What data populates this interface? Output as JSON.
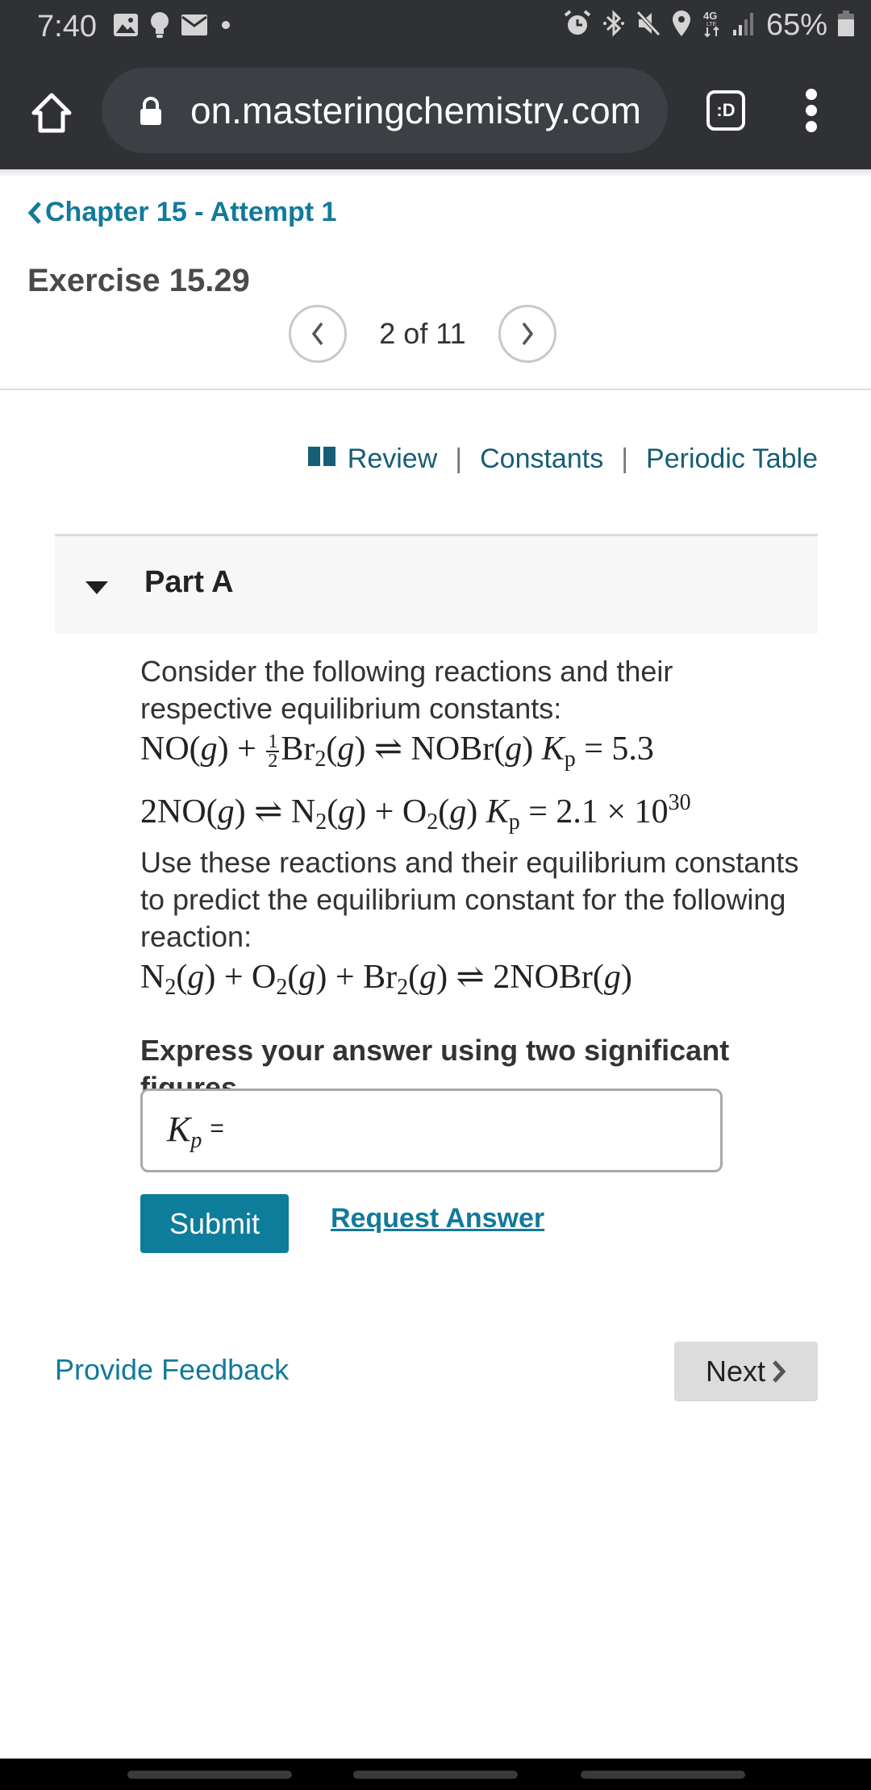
{
  "status_bar": {
    "time": "7:40",
    "left_icons": [
      "gallery-icon",
      "bulb-icon",
      "mail-icon",
      "dot-icon"
    ],
    "right_icons": [
      "alarm-icon",
      "bluetooth-icon",
      "mute-icon",
      "location-icon",
      "4g-lte-icon",
      "signal-icon"
    ],
    "battery_percent": "65%"
  },
  "browser": {
    "url": "on.masteringchemistry.com",
    "tab_switcher_label": ":D"
  },
  "header": {
    "back_link": "Chapter 15 - Attempt 1",
    "exercise_title": "Exercise 15.29",
    "pager": {
      "current": 2,
      "total": 11,
      "text": "2 of 11"
    }
  },
  "resources": {
    "review": "Review",
    "constants": "Constants",
    "periodic_table": "Periodic Table",
    "separator": "|"
  },
  "part": {
    "title": "Part A",
    "intro": "Consider the following reactions and their respective equilibrium constants:",
    "reaction1": {
      "a": "NO(",
      "frac_num": "1",
      "frac_den": "2",
      "b": "Br",
      "c": "NOBr(",
      "kp_label": "K",
      "kp_sub": "p",
      "kp_value": "= 5.3"
    },
    "reaction2": {
      "lhs": "2NO(",
      "n": "N",
      "o": "O",
      "kp_label": "K",
      "kp_sub": "p",
      "kp_value": "= 2.1 × 10",
      "kp_exp": "30"
    },
    "middle": "Use these reactions and their equilibrium constants to predict the equilibrium constant for the following reaction:",
    "target_reaction": {
      "n": "N",
      "o": "O",
      "br": "Br",
      "product": "2NOBr("
    },
    "instruction": "Express your answer using two significant figures.",
    "answer": {
      "label": "K",
      "label_sub": "p",
      "equals": "=",
      "value": "",
      "placeholder": ""
    },
    "submit": "Submit",
    "request_answer": "Request Answer"
  },
  "footer": {
    "feedback": "Provide Feedback",
    "next": "Next"
  },
  "colors": {
    "accent": "#127a9a",
    "submit_bg": "#0e7c9b",
    "resource_link": "#155e75",
    "chrome_bg": "#303134"
  }
}
